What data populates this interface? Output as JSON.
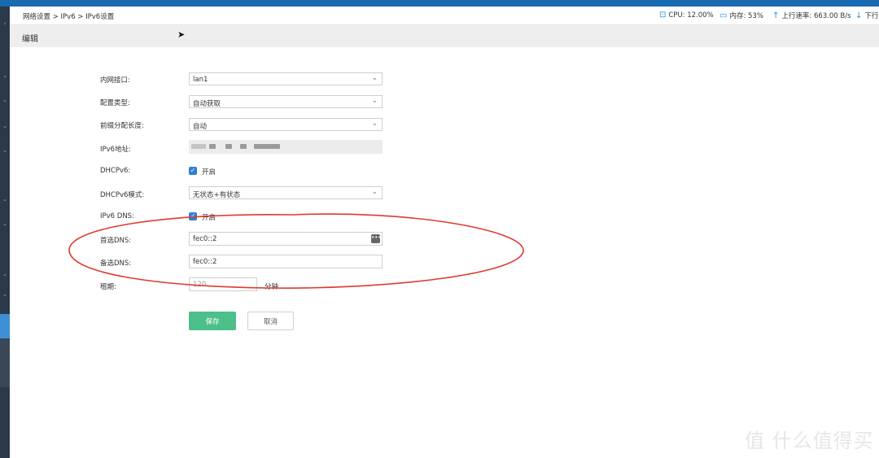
{
  "header": {
    "breadcrumb": "网络设置 > IPv6 > IPv6设置",
    "cpu": "CPU: 12.00%",
    "memory": "内存: 53%",
    "upload": "上行速率: 663.00 B/s",
    "download": "下行"
  },
  "page": {
    "title": "编辑"
  },
  "form": {
    "lan_label": "内网接口:",
    "lan_value": "lan1",
    "config_label": "配置类型:",
    "config_value": "自动获取",
    "prefix_label": "前缀分配长度:",
    "prefix_value": "自动",
    "ipv6_label": "IPv6地址:",
    "dhcpv6_label": "DHCPv6:",
    "dhcpv6_value": "开启",
    "dhcpv6_mode_label": "DHCPv6模式:",
    "dhcpv6_mode_value": "无状态+有状态",
    "ipv6dns_label": "IPv6 DNS:",
    "ipv6dns_value": "开启",
    "primary_dns_label": "首选DNS:",
    "primary_dns_value": "fec0::2",
    "secondary_dns_label": "备选DNS:",
    "secondary_dns_value": "fec0::2",
    "lease_label": "租期:",
    "lease_value": "120",
    "lease_unit": "分钟"
  },
  "buttons": {
    "save": "保存",
    "cancel": "取消"
  },
  "watermark": "值 什么值得买",
  "colors": {
    "accent": "#2d7fd3",
    "save": "#4cbf8b",
    "annotation": "#e03a2e",
    "topbar": "#1a6ab1"
  }
}
